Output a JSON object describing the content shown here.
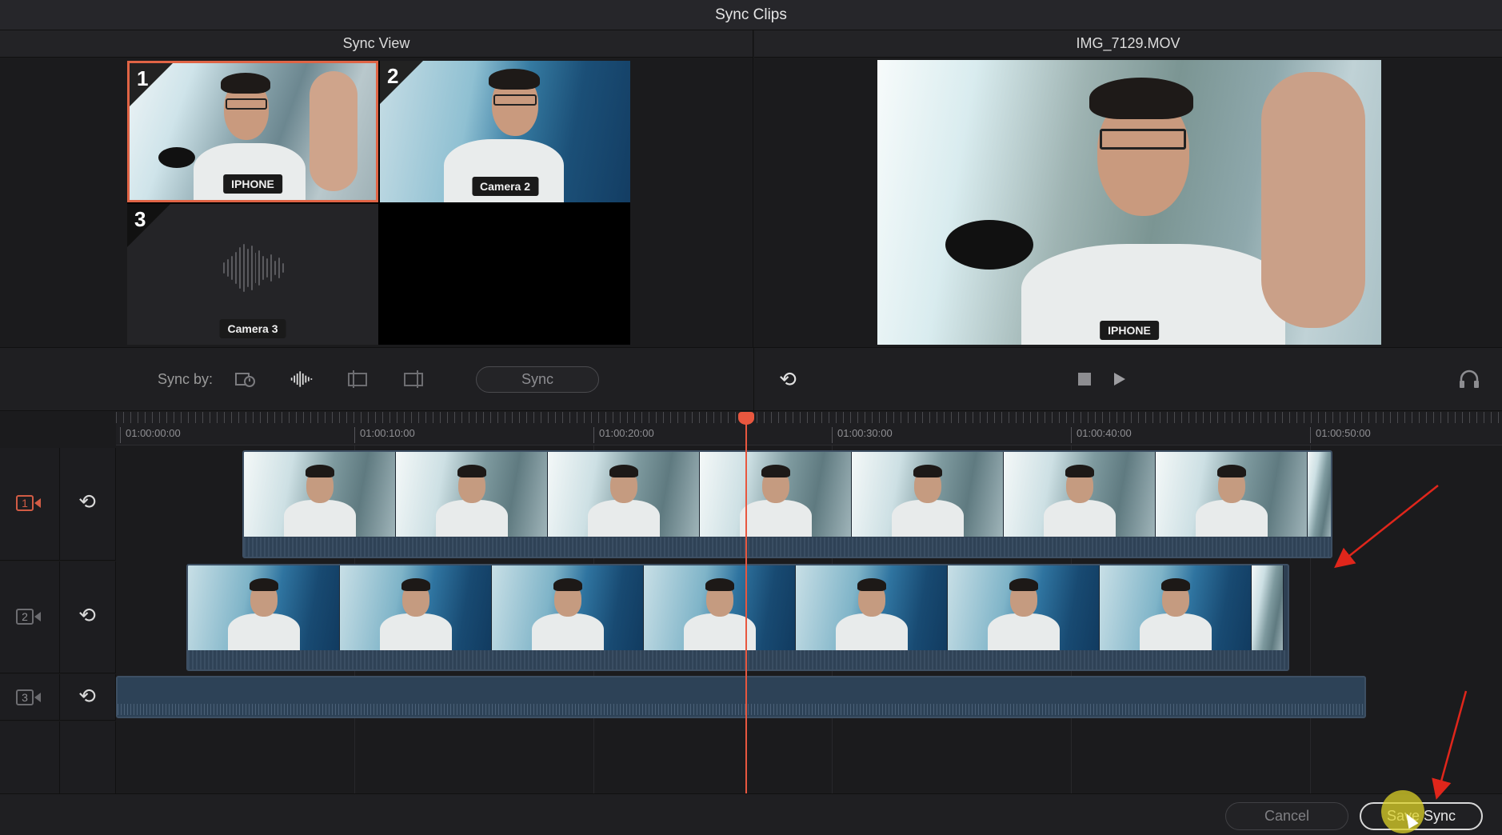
{
  "window": {
    "title": "Sync Clips"
  },
  "sync_view": {
    "header": "Sync View",
    "cells": [
      {
        "number": "1",
        "label": "IPHONE"
      },
      {
        "number": "2",
        "label": "Camera 2"
      },
      {
        "number": "3",
        "label": "Camera 3"
      }
    ]
  },
  "viewer": {
    "header": "IMG_7129.MOV",
    "label": "IPHONE"
  },
  "controls": {
    "sync_by_label": "Sync by:",
    "sync_button": "Sync",
    "icons": [
      "timecode-sync-icon",
      "waveform-sync-icon",
      "in-point-sync-icon",
      "out-point-sync-icon",
      "link-icon",
      "stop-icon",
      "play-icon",
      "headphones-icon"
    ]
  },
  "timeline": {
    "timecodes": [
      "01:00:00:00",
      "01:00:10:00",
      "01:00:20:00",
      "01:00:30:00",
      "01:00:40:00",
      "01:00:50:00"
    ],
    "tracks": [
      {
        "number": "1",
        "active": true
      },
      {
        "number": "2",
        "active": false
      },
      {
        "number": "3",
        "active": false
      }
    ]
  },
  "footer": {
    "cancel": "Cancel",
    "save": "Save Sync"
  },
  "colors": {
    "accent": "#e06445",
    "playhead": "#e8573f",
    "arrow": "#e0261b",
    "cursor_highlight": "#dcd228"
  }
}
